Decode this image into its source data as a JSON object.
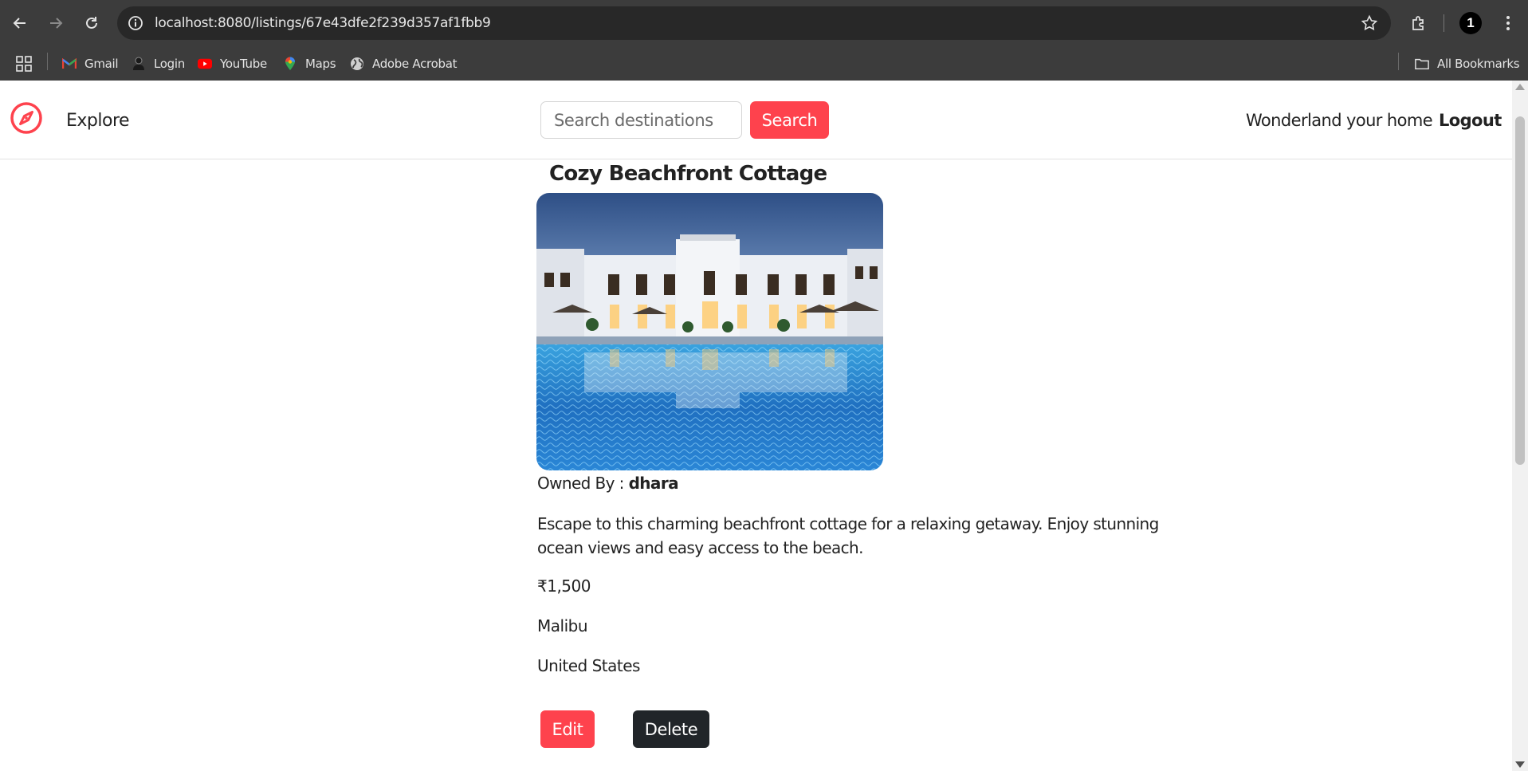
{
  "browser": {
    "url": "localhost:8080/listings/67e43dfe2f239d357af1fbb9",
    "profile_initial": "1",
    "bookmarks": [
      {
        "label": "Gmail",
        "icon": "gmail-icon"
      },
      {
        "label": "Login",
        "icon": "login-icon"
      },
      {
        "label": "YouTube",
        "icon": "youtube-icon"
      },
      {
        "label": "Maps",
        "icon": "maps-icon"
      },
      {
        "label": "Adobe Acrobat",
        "icon": "globe-icon"
      }
    ],
    "all_bookmarks": "All Bookmarks"
  },
  "navbar": {
    "explore": "Explore",
    "search_placeholder": "Search destinations",
    "search_button": "Search",
    "host_link": "Wonderland your home",
    "logout": "Logout"
  },
  "listing": {
    "title": "Cozy Beachfront Cottage",
    "owner_label": "Owned By :",
    "owner_name": "dhara",
    "description": "Escape to this charming beachfront cottage for a relaxing getaway. Enjoy stunning ocean views and easy access to the beach.",
    "price": "₹1,500",
    "location": "Malibu",
    "country": "United States",
    "edit_button": "Edit",
    "delete_button": "Delete"
  },
  "colors": {
    "brand": "#fe424d",
    "dark_button": "#212529",
    "chrome": "#3c3c3c"
  }
}
